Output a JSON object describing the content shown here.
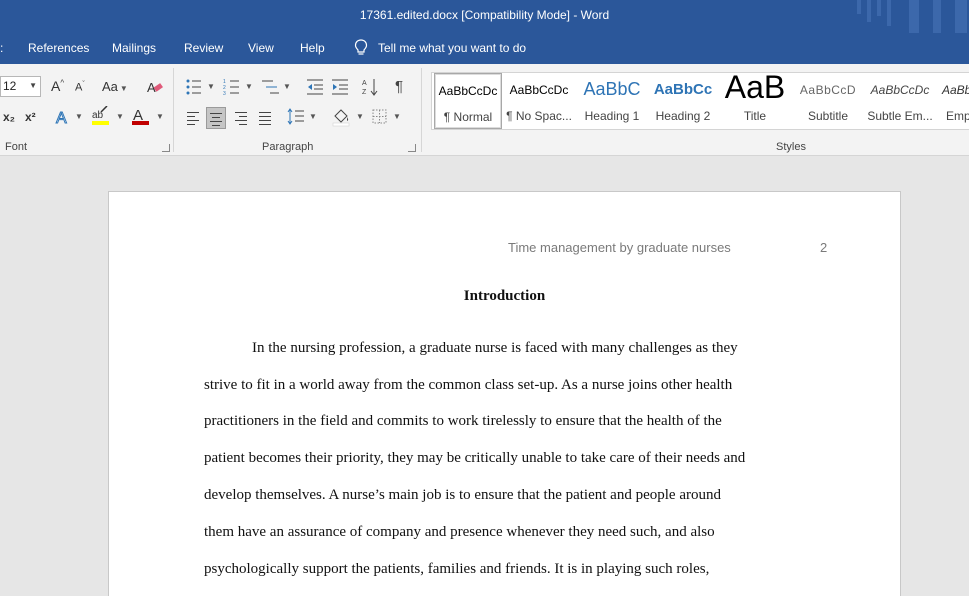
{
  "window": {
    "title": "17361.edited.docx [Compatibility Mode]  -  Word"
  },
  "menu": {
    "tabs": [
      "References",
      "Mailings",
      "Review",
      "View",
      "Help"
    ],
    "tell_me": "Tell me what you want to do"
  },
  "ribbon": {
    "font": {
      "size": "12",
      "label": "Font",
      "grow_label": "A",
      "shrink_label": "A",
      "case_label": "Aa",
      "subscript_label": "x₂",
      "superscript_label": "x²",
      "highlight_color": "#ffff00",
      "font_color": "#c00000"
    },
    "paragraph": {
      "label": "Paragraph"
    },
    "styles": {
      "label": "Styles",
      "items": [
        {
          "sample": "AaBbCcDc",
          "name": "¶ Normal"
        },
        {
          "sample": "AaBbCcDc",
          "name": "¶ No Spac..."
        },
        {
          "sample": "AaBbC",
          "name": "Heading 1"
        },
        {
          "sample": "AaBbCc",
          "name": "Heading 2"
        },
        {
          "sample": "AaB",
          "name": "Title"
        },
        {
          "sample": "AaBbCcD",
          "name": "Subtitle"
        },
        {
          "sample": "AaBbCcDc",
          "name": "Subtle Em..."
        },
        {
          "sample": "AaBbC",
          "name": "Emp"
        }
      ]
    }
  },
  "document": {
    "header_text": "Time management by graduate nurses",
    "page_number": "2",
    "heading": "Introduction",
    "lines": [
      "In the nursing profession, a graduate nurse is faced with many challenges as they",
      "strive to fit in a world away from the common class set-up. As a nurse joins other health",
      "practitioners in the field and commits to work tirelessly to ensure that the health of the",
      "patient becomes their priority, they may be critically unable to take care of their needs and",
      "develop themselves. A nurse’s main job is to ensure that the patient and people around",
      "them have an assurance of company and presence whenever they need such, and also",
      "psychologically support the patients, families and friends. It is in playing such roles,"
    ]
  },
  "colors": {
    "brand": "#2b579a",
    "ribbon": "#f3f3f3",
    "canvas": "#e6e6e6"
  }
}
